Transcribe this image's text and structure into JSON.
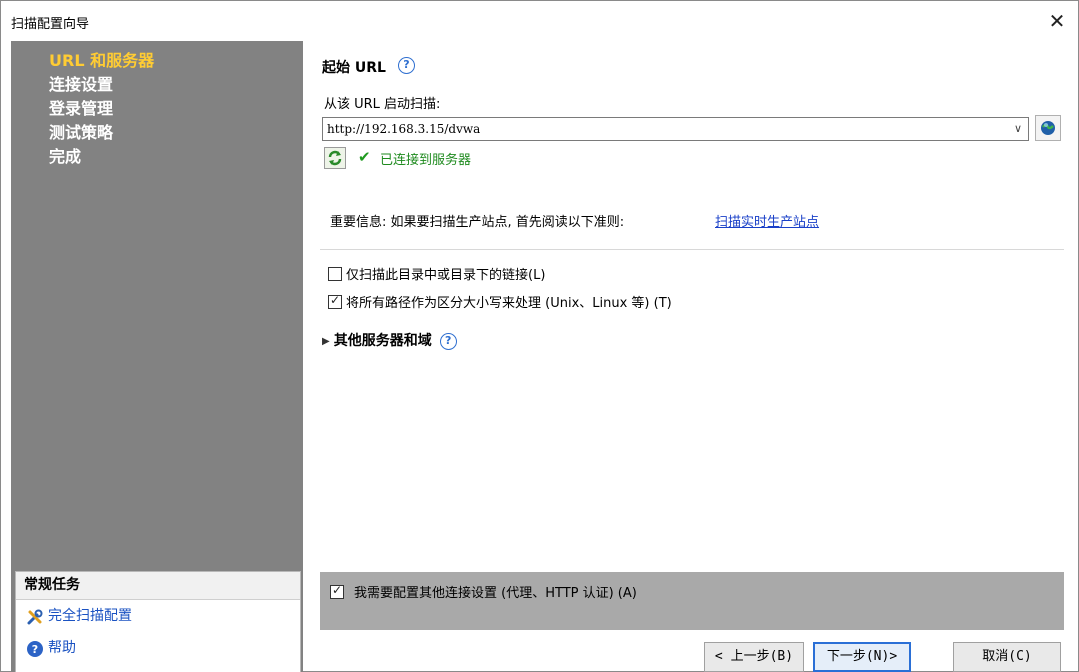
{
  "window": {
    "title": "扫描配置向导",
    "close_glyph": "✕"
  },
  "sidebar": {
    "steps": [
      {
        "label": "URL 和服务器",
        "active": true
      },
      {
        "label": "连接设置",
        "active": false
      },
      {
        "label": "登录管理",
        "active": false
      },
      {
        "label": "测试策略",
        "active": false
      },
      {
        "label": "完成",
        "active": false
      }
    ],
    "tasks": {
      "header": "常规任务",
      "items": [
        {
          "label": "完全扫描配置",
          "icon": "tools-icon"
        },
        {
          "label": "帮助",
          "icon": "help-icon"
        }
      ]
    }
  },
  "main": {
    "section_title": "起始 URL",
    "help_glyph": "?",
    "start_label": "从该 URL 启动扫描:",
    "url_value": "http://192.168.3.15/dvwa",
    "dropdown_glyph": "∨",
    "connection_status": "已连接到服务器",
    "important_text": "重要信息: 如果要扫描生产站点, 首先阅读以下准则:",
    "important_link": "扫描实时生产站点",
    "checkboxes": [
      {
        "label": "仅扫描此目录中或目录下的链接(L)",
        "checked": false
      },
      {
        "label": "将所有路径作为区分大小写来处理 (Unix、Linux 等) (T)",
        "checked": true
      }
    ],
    "expander_label": "其他服务器和域",
    "proxy_checkbox": {
      "label": "我需要配置其他连接设置 (代理、HTTP 认证) (A)",
      "checked": true
    }
  },
  "buttons": {
    "prev": "< 上一步(B)",
    "next": "下一步(N)>",
    "cancel": "取消(C)"
  },
  "colors": {
    "sidebar_bg": "#828282",
    "active_step": "#ffcc33",
    "link": "#1a40c8",
    "success": "#1e8a1e"
  }
}
